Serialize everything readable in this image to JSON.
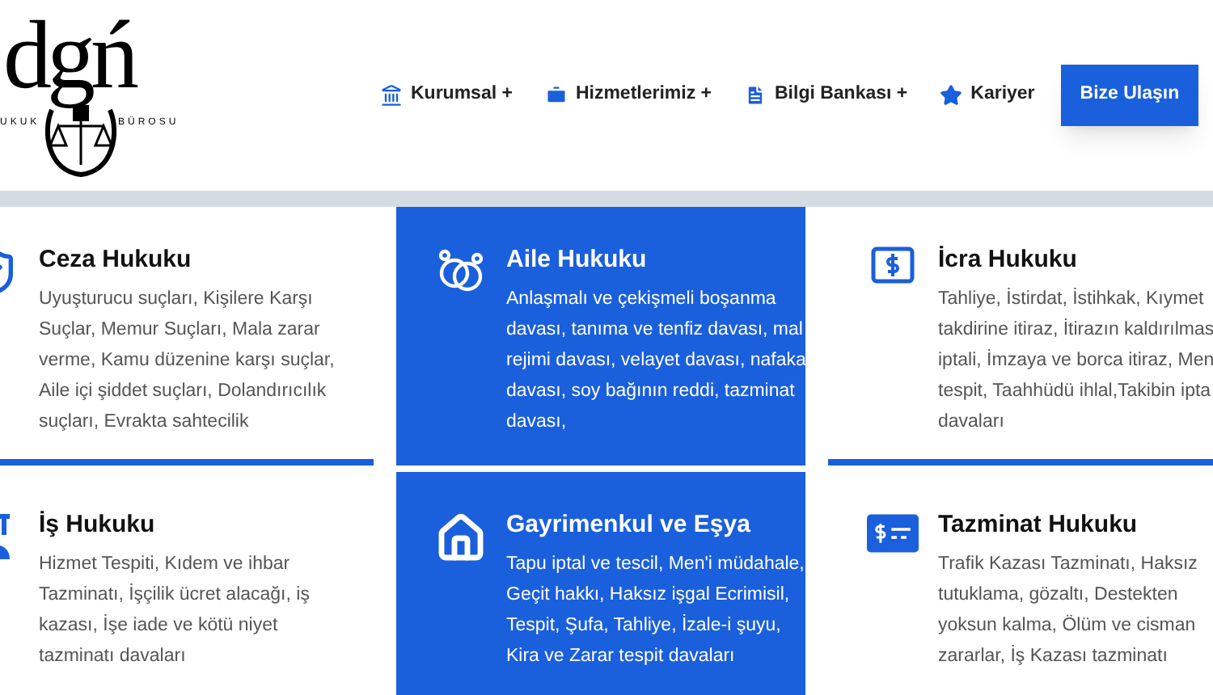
{
  "logo": {
    "mark": "dgń",
    "left_caption": "UKUK",
    "right_caption": "BÜROSU"
  },
  "nav": [
    {
      "label": "Kurumsal +"
    },
    {
      "label": "Hizmetlerimiz +"
    },
    {
      "label": "Bilgi Bankası +"
    },
    {
      "label": "Kariyer"
    }
  ],
  "cta": "Bize Ulaşın",
  "services": [
    {
      "title": "Ceza Hukuku",
      "selected": false,
      "lines": [
        "Uyuşturucu suçları, Kişilere Karşı",
        "Suçlar, Memur Suçları, Mala zarar",
        "verme, Kamu düzenine karşı suçlar,",
        "Aile içi şiddet suçları, Dolandırıcılık",
        "suçları, Evrakta sahtecilik"
      ]
    },
    {
      "title": "Aile Hukuku",
      "selected": true,
      "lines": [
        "Anlaşmalı ve çekişmeli boşanma",
        "davası, tanıma ve tenfiz davası, mal",
        "rejimi davası, velayet davası, nafaka",
        "davası, soy bağının reddi, tazminat",
        "davası,"
      ]
    },
    {
      "title": "İcra Hukuku",
      "selected": false,
      "lines": [
        "Tahliye, İstirdat, İstihkak, Kıymet",
        "takdirine itiraz, İtirazın kaldırılmas",
        "iptali, İmzaya ve borca itiraz, Men",
        "tespit, Taahhüdü ihlal,Takibin ipta",
        "davaları"
      ]
    },
    {
      "title": "İş Hukuku",
      "selected": false,
      "lines": [
        "Hizmet Tespiti, Kıdem ve ihbar",
        "Tazminatı, İşçilik ücret alacağı, iş",
        "kazası, İşe iade ve kötü niyet",
        "tazminatı davaları"
      ]
    },
    {
      "title": "Gayrimenkul ve Eşya",
      "selected": true,
      "lines": [
        "Tapu iptal ve tescil, Men'i müdahale,",
        "Geçit hakkı, Haksız işgal Ecrimisil,",
        "Tespit, Şufa, Tahliye, İzale-i şuyu,",
        "Kira ve Zarar tespit davaları"
      ]
    },
    {
      "title": "Tazminat Hukuku",
      "selected": false,
      "lines": [
        "Trafik Kazası Tazminatı, Haksız",
        "tutuklama, gözaltı, Destekten",
        "yoksun kalma, Ölüm ve cisman",
        "zararlar, İş Kazası tazminatı"
      ]
    }
  ]
}
